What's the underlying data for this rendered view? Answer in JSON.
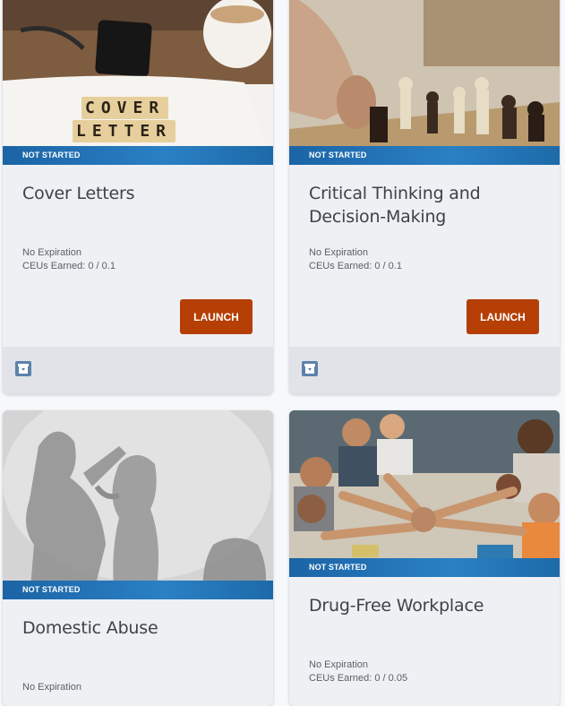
{
  "courses": [
    {
      "title": "Cover Letters",
      "status": "NOT STARTED",
      "expiration": "No Expiration",
      "ceus": "CEUs Earned: 0 / 0.1",
      "action_label": "LAUNCH",
      "image_text": [
        "COVER",
        "LETTER"
      ]
    },
    {
      "title": "Critical Thinking and Decision-Making",
      "status": "NOT STARTED",
      "expiration": "No Expiration",
      "ceus": "CEUs Earned: 0 / 0.1",
      "action_label": "LAUNCH"
    },
    {
      "title": "Domestic Abuse",
      "status": "NOT STARTED",
      "expiration": "No Expiration"
    },
    {
      "title": "Drug-Free Workplace",
      "status": "NOT STARTED",
      "expiration": "No Expiration",
      "ceus": "CEUs Earned: 0 / 0.05"
    }
  ],
  "icons": {
    "footer": "archive-icon"
  },
  "colors": {
    "launch": "#b53f05",
    "status_bar": "#2278bc",
    "archive": "#5c82aa"
  }
}
